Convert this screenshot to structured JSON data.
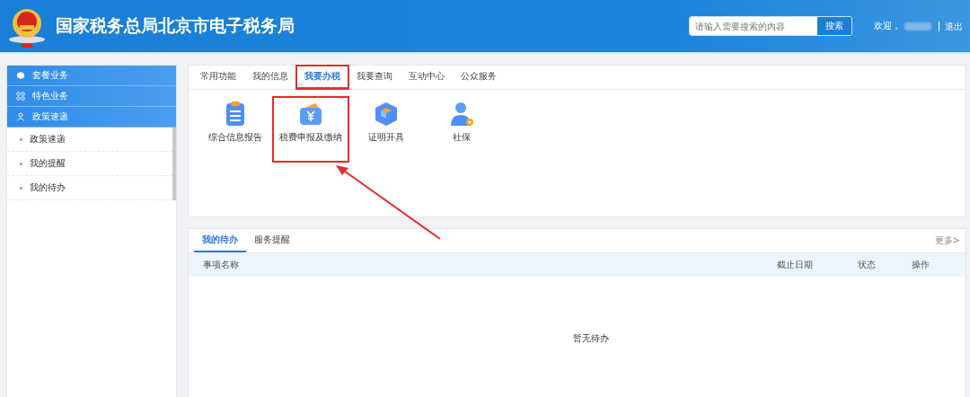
{
  "header": {
    "title": "国家税务总局北京市电子税务局",
    "search": {
      "placeholder": "请输入需要搜索的内容",
      "button": "搜索"
    },
    "welcome": "欢迎，",
    "logout": "退出"
  },
  "sidebar": {
    "groups": [
      {
        "label": "套餐业务"
      },
      {
        "label": "特色业务"
      },
      {
        "label": "政策速递"
      }
    ],
    "items": [
      {
        "label": "政策速递"
      },
      {
        "label": "我的提醒"
      },
      {
        "label": "我的待办"
      }
    ]
  },
  "tabs": [
    {
      "label": "常用功能",
      "selected": false,
      "highlighted": false
    },
    {
      "label": "我的信息",
      "selected": false,
      "highlighted": false
    },
    {
      "label": "我要办税",
      "selected": true,
      "highlighted": true
    },
    {
      "label": "我要查询",
      "selected": false,
      "highlighted": false
    },
    {
      "label": "互动中心",
      "selected": false,
      "highlighted": false
    },
    {
      "label": "公众服务",
      "selected": false,
      "highlighted": false
    }
  ],
  "functions": [
    {
      "label": "综合信息报告",
      "kind": "clipboard",
      "highlighted": false
    },
    {
      "label": "税费申报及缴纳",
      "kind": "wallet",
      "highlighted": true
    },
    {
      "label": "证明开具",
      "kind": "box",
      "highlighted": false
    },
    {
      "label": "社保",
      "kind": "user",
      "highlighted": false
    }
  ],
  "todo": {
    "tabs": [
      {
        "label": "我的待办",
        "selected": true
      },
      {
        "label": "服务提醒",
        "selected": false
      }
    ],
    "more": "更多>",
    "columns": [
      "事项名称",
      "截止日期",
      "状态",
      "操作"
    ],
    "empty": "暂无待办"
  }
}
